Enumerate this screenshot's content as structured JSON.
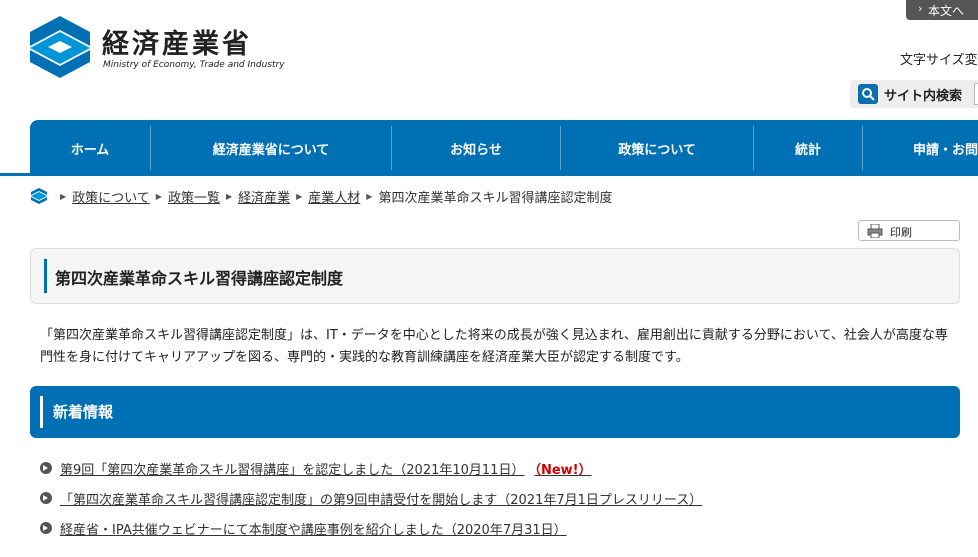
{
  "header": {
    "skip_link": "本文へ",
    "logo_jp": "経済産業省",
    "logo_en": "Ministry of Economy, Trade and Industry",
    "font_size_label": "文字サイズ変",
    "search_label": "サイト内検索"
  },
  "nav": {
    "items": [
      {
        "label": "ホーム"
      },
      {
        "label": "経済産業省について"
      },
      {
        "label": "お知らせ"
      },
      {
        "label": "政策について"
      },
      {
        "label": "統計"
      },
      {
        "label": "申請・お問"
      }
    ]
  },
  "breadcrumb": {
    "items": [
      "政策について",
      "政策一覧",
      "経済産業",
      "産業人材"
    ],
    "current": "第四次産業革命スキル習得講座認定制度"
  },
  "print_label": "印刷",
  "page_title": "第四次産業革命スキル習得講座認定制度",
  "intro": "「第四次産業革命スキル習得講座認定制度」は、IT・データを中心とした将来の成長が強く見込まれ、雇用創出に貢献する分野において、社会人が高度な専門性を身に付けてキャリアアップを図る、専門的・実践的な教育訓練講座を経済産業大臣が認定する制度です。",
  "news": {
    "title": "新着情報",
    "items": [
      {
        "text": "第9回「第四次産業革命スキル習得講座」を認定しました（2021年10月11日）",
        "badge": "（New!）"
      },
      {
        "text": "「第四次産業革命スキル習得講座認定制度」の第9回申請受付を開始します（2021年7月1日プレスリリース）",
        "badge": ""
      },
      {
        "text": "経産省・IPA共催ウェビナーにて本制度や講座事例を紹介しました（2020年7月31日）",
        "badge": ""
      }
    ]
  },
  "colors": {
    "brand_blue": "#0070b4",
    "new_badge_red": "#d40000"
  },
  "icons": {
    "logo": "meti-logo-mark",
    "search": "search-icon",
    "print": "print-icon",
    "breadcrumb_home": "home-logo-icon",
    "news_bullet": "arrow-circle-icon"
  }
}
